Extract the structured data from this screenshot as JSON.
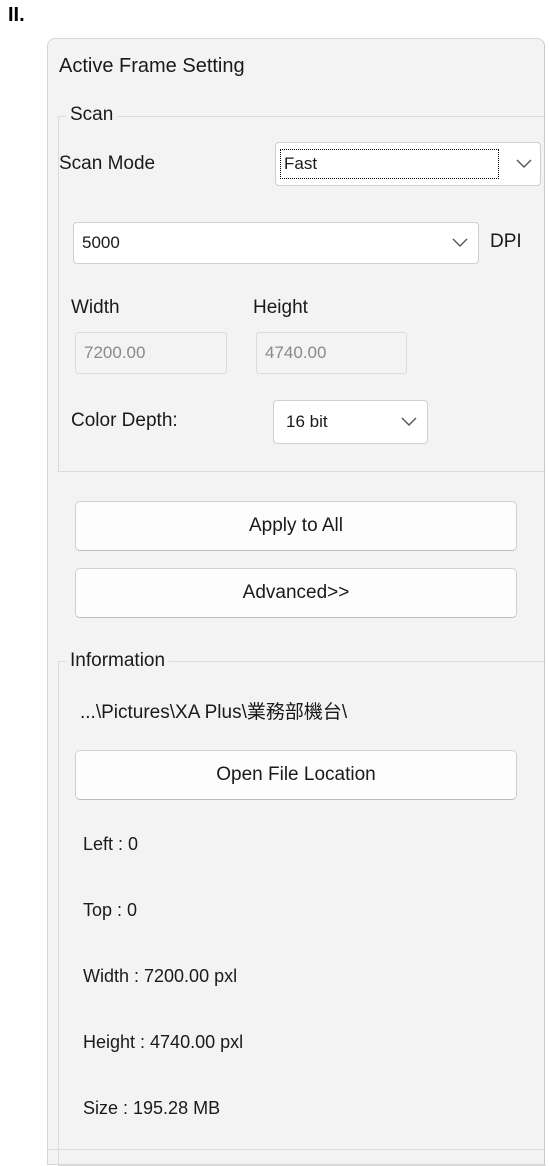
{
  "heading": "II.",
  "panel": {
    "title": "Active Frame Setting",
    "scan": {
      "group_label": "Scan",
      "scan_mode_label": "Scan Mode",
      "scan_mode_value": "Fast",
      "dpi_value": "5000",
      "dpi_label": "DPI",
      "width_label": "Width",
      "height_label": "Height",
      "width_value": "7200.00",
      "height_value": "4740.00",
      "color_depth_label": "Color Depth:",
      "color_depth_value": "16 bit"
    },
    "buttons": {
      "apply_all": "Apply to All",
      "advanced": "Advanced>>",
      "open_location": "Open File Location"
    },
    "information": {
      "group_label": "Information",
      "path": "...\\Pictures\\XA Plus\\業務部機台\\",
      "left": "Left : 0",
      "top": "Top : 0",
      "width": "Width : 7200.00 pxl",
      "height": "Height : 4740.00 pxl",
      "size": "Size : 195.28 MB"
    }
  },
  "icons": {
    "dropdown": "chevron-down-icon"
  }
}
